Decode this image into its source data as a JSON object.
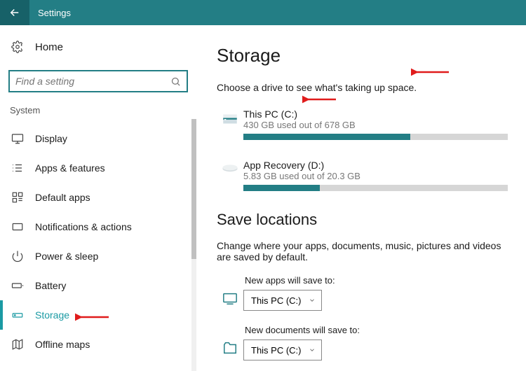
{
  "titlebar": {
    "title": "Settings"
  },
  "sidebar": {
    "home_label": "Home",
    "search_placeholder": "Find a setting",
    "section_label": "System",
    "items": [
      {
        "label": "Display"
      },
      {
        "label": "Apps & features"
      },
      {
        "label": "Default apps"
      },
      {
        "label": "Notifications & actions"
      },
      {
        "label": "Power & sleep"
      },
      {
        "label": "Battery"
      },
      {
        "label": "Storage"
      },
      {
        "label": "Offline maps"
      }
    ]
  },
  "main": {
    "heading": "Storage",
    "subtext": "Choose a drive to see what's taking up space.",
    "drives": [
      {
        "name": "This PC (C:)",
        "used_text": "430 GB used out of 678 GB",
        "fill_pct": 63
      },
      {
        "name": "App Recovery (D:)",
        "used_text": "5.83 GB used out of 20.3 GB",
        "fill_pct": 29
      }
    ],
    "save_heading": "Save locations",
    "save_desc": "Change where your apps, documents, music, pictures and videos are saved by default.",
    "save_rows": [
      {
        "label": "New apps will save to:",
        "value": "This PC (C:)"
      },
      {
        "label": "New documents will save to:",
        "value": "This PC (C:)"
      }
    ]
  }
}
